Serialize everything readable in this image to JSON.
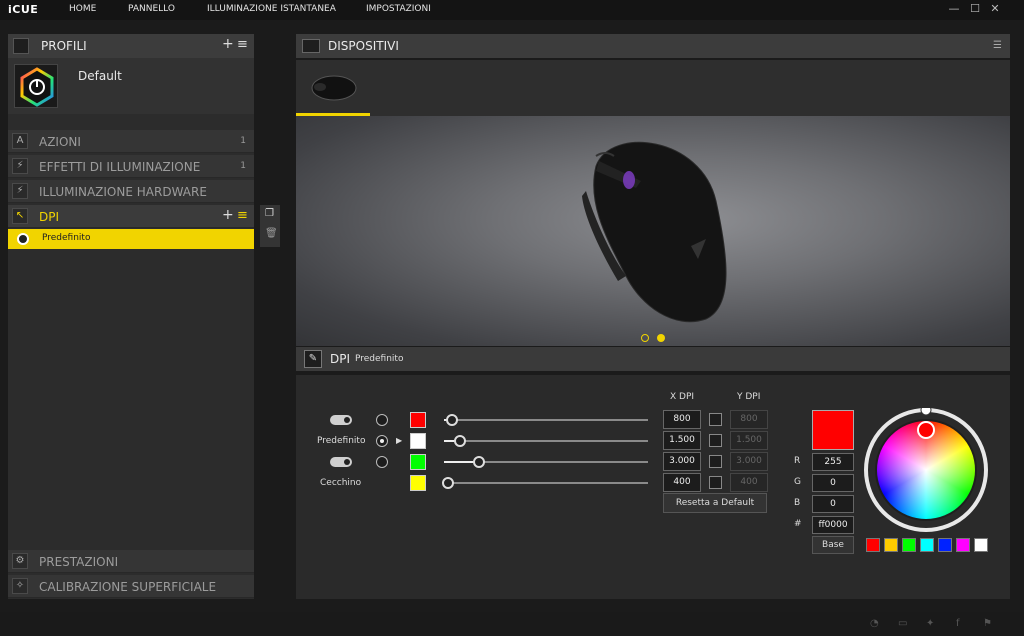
{
  "app": {
    "title": "iCUE"
  },
  "nav": [
    "HOME",
    "PANNELLO",
    "ILLUMINAZIONE ISTANTANEA",
    "IMPOSTAZIONI"
  ],
  "window": {
    "minimize": "—",
    "maximize": "☐",
    "close": "✕"
  },
  "profiles": {
    "title": "PROFILI",
    "add": "+",
    "menu": "≡",
    "active_profile": "Default"
  },
  "sections": [
    {
      "label": "AZIONI",
      "count": "1",
      "icon": "A"
    },
    {
      "label": "EFFETTI DI ILLUMINAZIONE",
      "count": "1",
      "icon": "⚡"
    },
    {
      "label": "ILLUMINAZIONE HARDWARE",
      "count": "",
      "icon": "⚡"
    },
    {
      "label": "DPI",
      "count": "",
      "icon": "↖"
    }
  ],
  "dpi_profiles": [
    {
      "label": "Predefinito"
    }
  ],
  "bottom_sections": [
    {
      "label": "PRESTAZIONI",
      "icon": "⚙"
    },
    {
      "label": "CALIBRAZIONE SUPERFICIALE",
      "icon": "✧"
    }
  ],
  "devices": {
    "title": "DISPOSITIVI",
    "menu": "☰"
  },
  "dpi_panel": {
    "title": "DPI",
    "subtitle": "Predefinito",
    "x_header": "X DPI",
    "y_header": "Y DPI",
    "reset_label": "Resetta a Default",
    "stages": [
      {
        "label": "",
        "toggle": true,
        "selected": false,
        "color": "#ff0000",
        "x": "800",
        "y": "800",
        "fraction": 0.02
      },
      {
        "label": "Predefinito",
        "toggle": false,
        "selected": true,
        "color": "#ffffff",
        "x": "1.500",
        "y": "1.500",
        "fraction": 0.06
      },
      {
        "label": "",
        "toggle": true,
        "selected": false,
        "color": "#00ff00",
        "x": "3.000",
        "y": "3.000",
        "fraction": 0.15
      },
      {
        "label": "Cecchino",
        "toggle": false,
        "selected": false,
        "color": "#ffff00",
        "x": "400",
        "y": "400",
        "fraction": 0.0
      }
    ]
  },
  "color_picker": {
    "current": "#ff0000",
    "r_label": "R",
    "r": "255",
    "g_label": "G",
    "g": "0",
    "b_label": "B",
    "b": "0",
    "hex_label": "#",
    "hex": "ff0000",
    "base_label": "Base",
    "presets": [
      "#ff0000",
      "#ffcc00",
      "#00ff00",
      "#00ffff",
      "#0022ff",
      "#ff00ff",
      "#ffffff"
    ]
  },
  "footer_icons": [
    "gauge-icon",
    "chat-icon",
    "twitter-icon",
    "facebook-icon",
    "corsair-icon"
  ],
  "accent": "#f1d400"
}
